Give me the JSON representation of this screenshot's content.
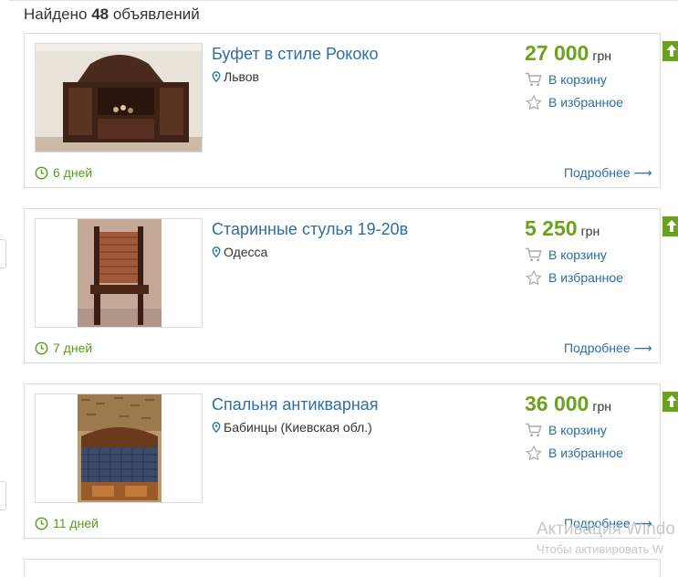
{
  "results": {
    "prefix": "Найдено",
    "count": "48",
    "suffix": "объявлений"
  },
  "listings": [
    {
      "title": "Буфет в стиле Рококо",
      "location": "Львов",
      "price": "27 000",
      "currency": "грн",
      "cart_label": "В корзину",
      "fav_label": "В избранное",
      "age": "6 дней",
      "more_label": "Подробнее ⟶"
    },
    {
      "title": "Старинные стулья 19-20в",
      "location": "Одесса",
      "price": "5 250",
      "currency": "грн",
      "cart_label": "В корзину",
      "fav_label": "В избранное",
      "age": "7 дней",
      "more_label": "Подробнее ⟶"
    },
    {
      "title": "Спальня антикварная",
      "location": "Бабинцы (Киевская обл.)",
      "price": "36 000",
      "currency": "грн",
      "cart_label": "В корзину",
      "fav_label": "В избранное",
      "age": "11 дней",
      "more_label": "Подробнее ⟶"
    }
  ],
  "icons": {
    "location": "map-pin-icon",
    "cart": "shopping-cart-icon",
    "favorite": "star-icon",
    "age": "clock-icon",
    "promote": "arrow-up-icon"
  },
  "colors": {
    "accent_green": "#6aa31b",
    "link_blue": "#2c6ea5"
  },
  "watermark": {
    "line1": "Активация Windo",
    "line2": "Чтобы активировать W"
  }
}
